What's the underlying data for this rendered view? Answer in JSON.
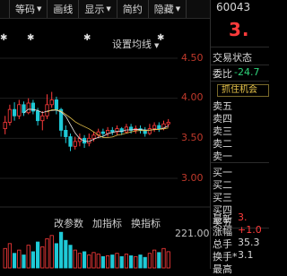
{
  "toolbar": {
    "items": [
      {
        "label": "等码",
        "caret": true
      },
      {
        "label": "画线",
        "caret": false
      },
      {
        "label": "显示",
        "caret": true
      },
      {
        "label": "简约",
        "caret": false
      },
      {
        "label": "隐藏",
        "caret": true
      }
    ]
  },
  "chart": {
    "setting_label": "设置均线",
    "price_ticks": [
      "4.50",
      "4.00",
      "3.50",
      "3.00"
    ],
    "volume_label": "221.00",
    "indicators": [
      "改参数",
      "加指标",
      "换指标"
    ],
    "colors": {
      "up": "#ff3b3b",
      "down": "#1fc9d6",
      "ma1": "#e6e6e6",
      "ma2": "#e7c34a",
      "vol_down": "#1fc9d6"
    },
    "icons": {
      "star": "asterisk-icon",
      "caret": "caret-down-icon"
    }
  },
  "chart_data": {
    "type": "candlestick",
    "y_ticks": [
      4.5,
      4.0,
      3.5,
      3.0
    ],
    "note": "approximate daily candles read from the screen",
    "candles": [
      {
        "o": 3.62,
        "c": 3.7,
        "h": 3.78,
        "l": 3.55
      },
      {
        "o": 3.7,
        "c": 3.86,
        "h": 3.92,
        "l": 3.66
      },
      {
        "o": 3.86,
        "c": 3.78,
        "h": 3.95,
        "l": 3.72
      },
      {
        "o": 3.78,
        "c": 3.92,
        "h": 3.98,
        "l": 3.74
      },
      {
        "o": 3.92,
        "c": 3.82,
        "h": 3.96,
        "l": 3.78
      },
      {
        "o": 3.82,
        "c": 3.94,
        "h": 4.0,
        "l": 3.8
      },
      {
        "o": 3.94,
        "c": 3.84,
        "h": 3.98,
        "l": 3.8
      },
      {
        "o": 3.84,
        "c": 3.72,
        "h": 3.88,
        "l": 3.66
      },
      {
        "o": 3.72,
        "c": 3.78,
        "h": 3.84,
        "l": 3.6
      },
      {
        "o": 3.78,
        "c": 3.92,
        "h": 4.05,
        "l": 3.74
      },
      {
        "o": 3.92,
        "c": 3.98,
        "h": 4.08,
        "l": 3.88
      },
      {
        "o": 3.98,
        "c": 3.86,
        "h": 4.02,
        "l": 3.8
      },
      {
        "o": 3.86,
        "c": 3.6,
        "h": 3.88,
        "l": 3.52
      },
      {
        "o": 3.6,
        "c": 3.52,
        "h": 3.66,
        "l": 3.44
      },
      {
        "o": 3.52,
        "c": 3.4,
        "h": 3.56,
        "l": 3.34
      },
      {
        "o": 3.4,
        "c": 3.46,
        "h": 3.52,
        "l": 3.36
      },
      {
        "o": 3.46,
        "c": 3.5,
        "h": 3.56,
        "l": 3.4
      },
      {
        "o": 3.5,
        "c": 3.44,
        "h": 3.54,
        "l": 3.38
      },
      {
        "o": 3.44,
        "c": 3.5,
        "h": 3.56,
        "l": 3.4
      },
      {
        "o": 3.5,
        "c": 3.54,
        "h": 3.58,
        "l": 3.46
      },
      {
        "o": 3.54,
        "c": 3.58,
        "h": 3.62,
        "l": 3.5
      },
      {
        "o": 3.58,
        "c": 3.56,
        "h": 3.62,
        "l": 3.52
      },
      {
        "o": 3.56,
        "c": 3.6,
        "h": 3.64,
        "l": 3.52
      },
      {
        "o": 3.6,
        "c": 3.58,
        "h": 3.64,
        "l": 3.54
      },
      {
        "o": 3.58,
        "c": 3.62,
        "h": 3.66,
        "l": 3.54
      },
      {
        "o": 3.62,
        "c": 3.58,
        "h": 3.64,
        "l": 3.54
      },
      {
        "o": 3.58,
        "c": 3.64,
        "h": 3.68,
        "l": 3.56
      },
      {
        "o": 3.64,
        "c": 3.6,
        "h": 3.68,
        "l": 3.56
      },
      {
        "o": 3.6,
        "c": 3.62,
        "h": 3.66,
        "l": 3.56
      },
      {
        "o": 3.62,
        "c": 3.6,
        "h": 3.66,
        "l": 3.56
      },
      {
        "o": 3.6,
        "c": 3.56,
        "h": 3.64,
        "l": 3.52
      },
      {
        "o": 3.56,
        "c": 3.62,
        "h": 3.68,
        "l": 3.54
      },
      {
        "o": 3.62,
        "c": 3.66,
        "h": 3.7,
        "l": 3.58
      },
      {
        "o": 3.66,
        "c": 3.62,
        "h": 3.7,
        "l": 3.58
      },
      {
        "o": 3.62,
        "c": 3.68,
        "h": 3.72,
        "l": 3.6
      },
      {
        "o": 3.68,
        "c": 3.7,
        "h": 3.74,
        "l": 3.64
      }
    ],
    "volume": [
      120,
      150,
      90,
      110,
      80,
      140,
      100,
      160,
      130,
      180,
      200,
      150,
      220,
      170,
      140,
      110,
      90,
      100,
      80,
      95,
      85,
      70,
      75,
      80,
      90,
      70,
      85,
      75,
      70,
      80,
      65,
      90,
      110,
      95,
      120,
      100
    ],
    "vol_up": [
      true,
      true,
      false,
      true,
      false,
      true,
      false,
      false,
      true,
      true,
      true,
      false,
      false,
      false,
      false,
      true,
      true,
      false,
      true,
      true,
      true,
      false,
      true,
      false,
      true,
      false,
      true,
      false,
      true,
      false,
      false,
      true,
      true,
      false,
      true,
      true
    ]
  },
  "panel": {
    "code": "60043",
    "price": "3.",
    "trade_status": "交易状态",
    "weibi_label": "委比",
    "weibi_value": "-24.7",
    "grab_label": "抓住机会",
    "sell_labels": [
      "卖五",
      "卖四",
      "卖三",
      "卖二",
      "卖一"
    ],
    "buy_labels": [
      "买一",
      "买二",
      "买三",
      "买四",
      "买五"
    ],
    "stats": [
      {
        "label": "最新",
        "value": "3."
      },
      {
        "label": "涨幅",
        "value": "+1.0"
      },
      {
        "label": "总手",
        "value": "35.3"
      },
      {
        "label": "换手*",
        "value": "3.1"
      }
    ],
    "last_label": "最高"
  }
}
